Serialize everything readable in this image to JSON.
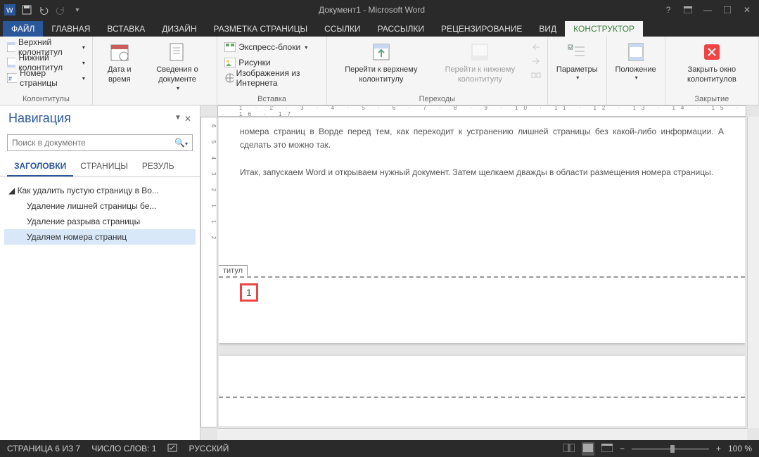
{
  "title": "Документ1 - Microsoft Word",
  "tabs": {
    "file": "ФАЙЛ",
    "items": [
      "ГЛАВНАЯ",
      "ВСТАВКА",
      "ДИЗАЙН",
      "РАЗМЕТКА СТРАНИЦЫ",
      "ССЫЛКИ",
      "РАССЫЛКИ",
      "РЕЦЕНЗИРОВАНИЕ",
      "ВИД"
    ],
    "active": "КОНСТРУКТОР"
  },
  "ribbon": {
    "g1": {
      "header": "Верхний колонтитул",
      "footer": "Нижний колонтитул",
      "pagenum": "Номер страницы",
      "label": "Колонтитулы"
    },
    "g2": {
      "date": "Дата и время",
      "docinfo": "Сведения о документе",
      "label": ""
    },
    "g3": {
      "quick": "Экспресс-блоки",
      "pics": "Рисунки",
      "online": "Изображения из Интернета",
      "label": "Вставка"
    },
    "g4": {
      "gotoHeader": "Перейти к верхнему колонтитулу",
      "gotoFooter": "Перейти к нижнему колонтитулу",
      "label": "Переходы"
    },
    "g5": {
      "params": "Параметры",
      "label": ""
    },
    "g6": {
      "position": "Положение",
      "label": ""
    },
    "g7": {
      "close": "Закрыть окно колонтитулов",
      "label": "Закрытие"
    }
  },
  "nav": {
    "title": "Навигация",
    "placeholder": "Поиск в документе",
    "tabs": {
      "headings": "ЗАГОЛОВКИ",
      "pages": "СТРАНИЦЫ",
      "results": "РЕЗУЛЬ"
    },
    "items": [
      "Как удалить пустую страницу в Во...",
      "Удаление лишней страницы бе...",
      "Удаление разрыва страницы",
      "Удаляем номера страниц"
    ]
  },
  "doc": {
    "para1": "номера страниц в Ворде перед тем, как переходит к устранению лишней страницы без какой-либо информации. А сделать это можно так.",
    "para2": "Итак, запускаем Word и открываем нужный документ. Затем щелкаем дважды в области размещения номера страницы.",
    "footerTab": "титул",
    "pageNum": "1"
  },
  "status": {
    "page": "СТРАНИЦА 6 ИЗ 7",
    "words": "ЧИСЛО СЛОВ: 1",
    "lang": "РУССКИЙ",
    "zoom": "100 %"
  },
  "ruler": {
    "h": "1 · 2 · 3 · 4 · 5 · 6 · 7 · 8 · 9 · 10 · 11 · 12 · 13 · 14 · 15 · 16 · 17",
    "v": "6 5 4 3 2 1   1 2"
  }
}
